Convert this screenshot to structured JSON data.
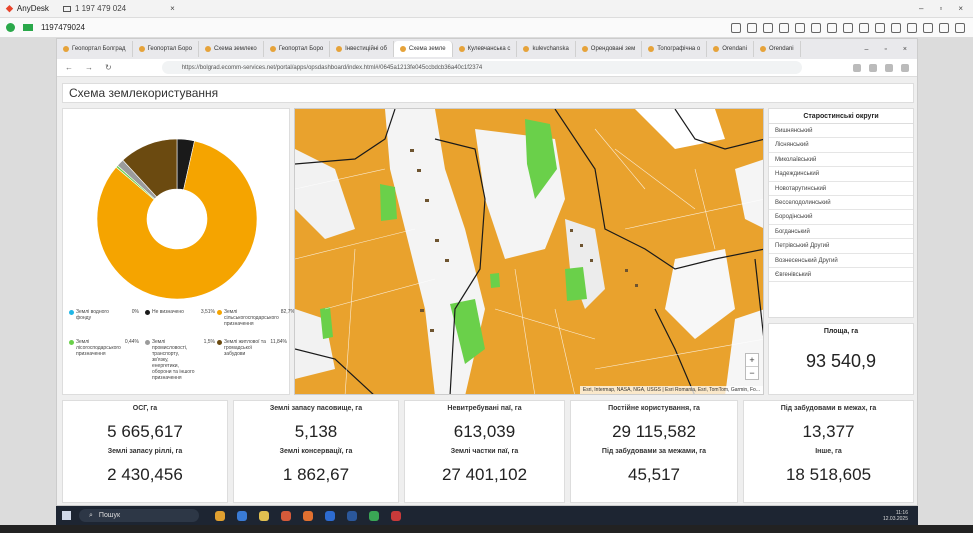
{
  "anydesk": {
    "app_name": "AnyDesk",
    "tab_label": "1 197 479 024",
    "address": "1197479024"
  },
  "browser": {
    "tabs": [
      {
        "label": "Геопортал Болград"
      },
      {
        "label": "Геопортал Боро"
      },
      {
        "label": "Схема землеко"
      },
      {
        "label": "Геопортал Боро"
      },
      {
        "label": "Інвестиційні об"
      },
      {
        "label": "Схема земле",
        "active": true
      },
      {
        "label": "Кулевчанська с"
      },
      {
        "label": "kulevchanska"
      },
      {
        "label": "Орендовані зем"
      },
      {
        "label": "Топографічна о"
      },
      {
        "label": "Orendani"
      },
      {
        "label": "Orendani"
      }
    ],
    "url": "https://bolgrad.ecomm-services.net/portal/apps/opsdashboard/index.html#/0645a1213fe045ccbdcb36a40c1f2374"
  },
  "dashboard": {
    "title": "Схема землекористування",
    "pie": {
      "colors": {
        "orange": "#f5a400",
        "brown": "#6b4a10",
        "black": "#1a1a1a",
        "green": "#6ad04a",
        "gray": "#9b9b9b",
        "cyan": "#21b7e6"
      },
      "legend": [
        {
          "label": "Землі водного фонду",
          "pct": "0%",
          "color": "#21b7e6"
        },
        {
          "label": "Не визначено",
          "pct": "3,51%",
          "color": "#1a1a1a"
        },
        {
          "label": "Землі сільськогосподарського призначення",
          "pct": "82,7%",
          "color": "#f5a400"
        },
        {
          "label": "Землі лісогосподарського призначення",
          "pct": "0,44%",
          "color": "#6ad04a"
        },
        {
          "label": "Землі промисловості, транспорту, зв'язку, енергетики, оборони та іншого призначення",
          "pct": "1,5%",
          "color": "#9b9b9b"
        },
        {
          "label": "Землі житлової та громадської забудови",
          "pct": "11,84%",
          "color": "#6b4a10"
        }
      ]
    },
    "map_attribution": "Esri, Intermap, NASA, NGA, USGS | Esri Romania, Esri, TomTom, Garmin, Fo...",
    "zoom_in": "+",
    "zoom_out": "−",
    "okrugy": {
      "title": "Старостинські округи",
      "items": [
        "Вишнянський",
        "Ліснянський",
        "Миколаївський",
        "Надеждинський",
        "Новотарутинський",
        "Весселодолинський",
        "Бородінський",
        "Богданський",
        "Петрівський Другий",
        "Вознесенський Другий",
        "Євгенівський"
      ]
    },
    "area": {
      "title": "Площа, га",
      "value": "93 540,9"
    },
    "cards": [
      {
        "t1": "ОСГ, га",
        "v1": "5 665,617",
        "t2": "Землі запасу ріллі, га",
        "v2": "2 430,456"
      },
      {
        "t1": "Землі запасу пасовище, га",
        "v1": "5,138",
        "t2": "Землі консервації, га",
        "v2": "1 862,67"
      },
      {
        "t1": "Невитребувані паї, га",
        "v1": "613,039",
        "t2": "Землі частки паї, га",
        "v2": "27 401,102"
      },
      {
        "t1": "Постійне користування, га",
        "v1": "29 115,582",
        "t2": "Під забудовами за межами, га",
        "v2": "45,517"
      },
      {
        "t1": "Під забудовами в межах, га",
        "v1": "13,377",
        "t2": "Інше, га",
        "v2": "18 518,605"
      }
    ]
  },
  "taskbar": {
    "search_label": "Пошук",
    "time": "11:16",
    "date": "12.03.2025"
  }
}
